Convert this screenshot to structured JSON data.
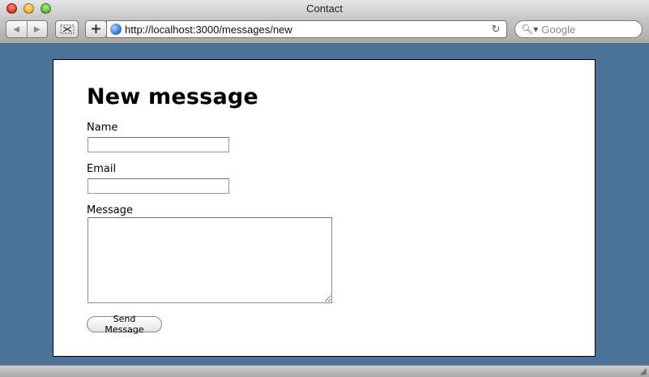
{
  "window": {
    "title": "Contact"
  },
  "toolbar": {
    "back_icon": "back-arrow-icon",
    "forward_icon": "forward-arrow-icon",
    "add_label": "+",
    "url": "http://localhost:3000/messages/new",
    "search_placeholder": "Google"
  },
  "form": {
    "heading": "New message",
    "name_label": "Name",
    "name_value": "",
    "email_label": "Email",
    "email_value": "",
    "message_label": "Message",
    "message_value": "",
    "submit_label": "Send Message"
  }
}
